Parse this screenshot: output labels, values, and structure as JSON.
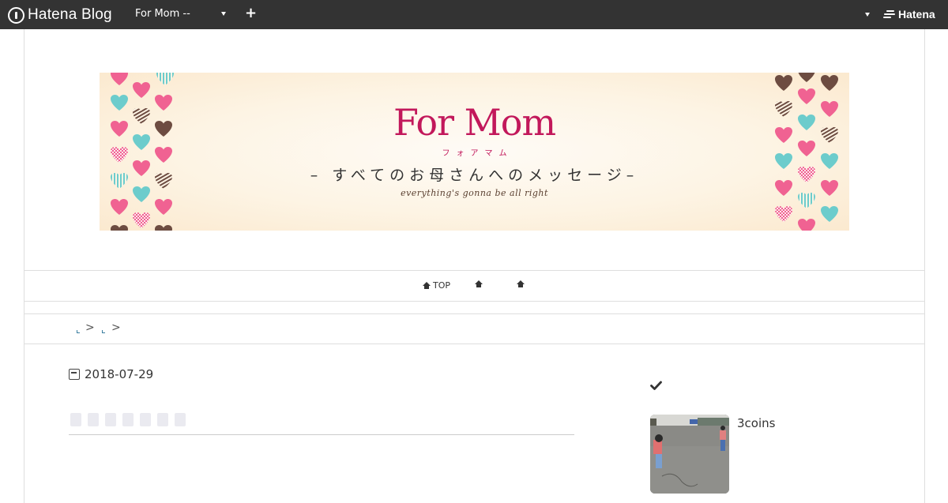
{
  "topbar": {
    "brand": "Hatena Blog",
    "blog_select": "For Mom --",
    "add_label": "+",
    "account_brand": "Hatena"
  },
  "banner": {
    "brand": "For Mom",
    "kana": "フォアマム",
    "message": "– すべてのお母さんへのメッセージ–",
    "tagline": "everything's gonna be all right"
  },
  "nav": {
    "items": [
      {
        "label": "TOP",
        "icon": "home-icon"
      },
      {
        "label": "",
        "icon": "home-icon"
      },
      {
        "label": "",
        "icon": "home-icon"
      }
    ]
  },
  "breadcrumb": {
    "separator": ">"
  },
  "article": {
    "date": "2018-07-29"
  },
  "sidebar": {
    "check_icon": "check-icon",
    "entry_title": "3coins"
  },
  "colors": {
    "topbar_bg": "#333333",
    "brand_magenta": "#c2185b",
    "heart_pink": "#f06292",
    "heart_teal": "#6ccccc",
    "heart_brown": "#6d4c41"
  }
}
